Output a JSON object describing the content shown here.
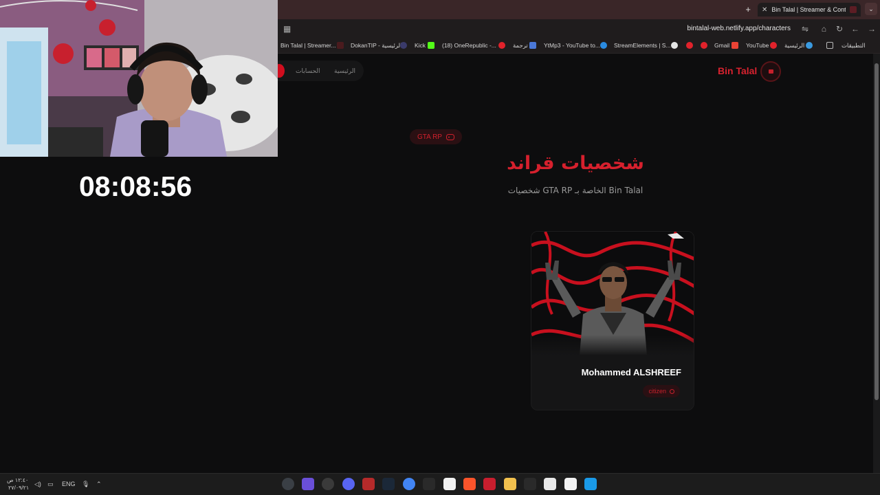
{
  "browser": {
    "tab_title": "Bin Talal | Streamer & Content C",
    "url": "bintalal-web.netlify.app/characters",
    "new_tab_icon": "plus-icon",
    "bookmarks": [
      {
        "label": "Bin Talal | Streamer..."
      },
      {
        "label": "DokanTIP - الرئيسية"
      },
      {
        "label": "Kick"
      },
      {
        "label": "(18) OneRepublic -..."
      },
      {
        "label": "ترجمة"
      },
      {
        "label": "YtMp3 - YouTube to..."
      },
      {
        "label": "StreamElements | S..."
      },
      {
        "label": "Gmail"
      },
      {
        "label": "YouTube"
      },
      {
        "label": "الرئيسية"
      },
      {
        "label": "التطبيقات"
      }
    ]
  },
  "overlay": {
    "timer": "08:08:56"
  },
  "site": {
    "brand": "Bin Talal",
    "nav": [
      {
        "label": "الرئيسية"
      },
      {
        "label": "الحسابات"
      }
    ],
    "badge": "GTA RP",
    "title": "شخصيات قراند",
    "subtitle": "شخصيات GTA RP الخاصة بـ Bin Talal",
    "characters": [
      {
        "name": "Mohammed ALSHREEF",
        "role": "citizen"
      }
    ]
  },
  "taskbar": {
    "time": "١٢:٤٠ ص",
    "date": "٢٧/٠٩/٢١",
    "lang": "ENG"
  },
  "colors": {
    "accent": "#d6202d",
    "background": "#0d0d0e",
    "card": "#151516"
  }
}
